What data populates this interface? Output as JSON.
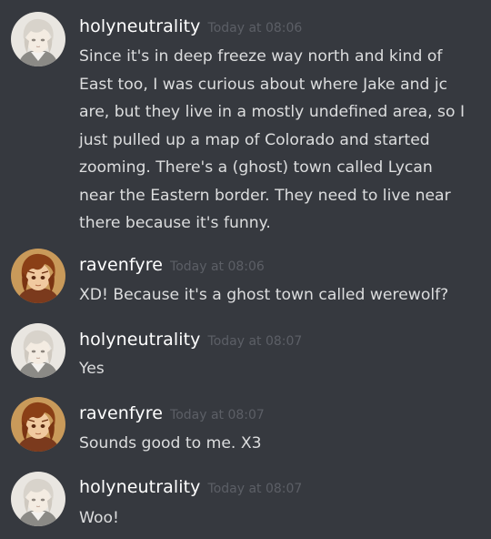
{
  "messages": [
    {
      "username": "holyneutrality",
      "timestamp": "Today at 08:06",
      "avatar": "holyneutrality-avatar",
      "text": "Since it's in deep freeze way north and kind of\nEast too, I was curious about where Jake and jc\nare, but they live in a mostly undefined area, so I\njust pulled up a map of Colorado and started\nzooming. There's a (ghost) town called Lycan\nnear the Eastern border. They need to live near\nthere because it's funny."
    },
    {
      "username": "ravenfyre",
      "timestamp": "Today at 08:06",
      "avatar": "ravenfyre-avatar",
      "text": "XD! Because it's a ghost town called werewolf?"
    },
    {
      "username": "holyneutrality",
      "timestamp": "Today at 08:07",
      "avatar": "holyneutrality-avatar",
      "text": "Yes"
    },
    {
      "username": "ravenfyre",
      "timestamp": "Today at 08:07",
      "avatar": "ravenfyre-avatar",
      "text": "Sounds good to me. X3"
    },
    {
      "username": "holyneutrality",
      "timestamp": "Today at 08:07",
      "avatar": "holyneutrality-avatar",
      "text": "Woo!"
    }
  ],
  "colors": {
    "background": "#36393f",
    "username": "#ffffff",
    "timestamp": "#5c5f66",
    "message_text": "#dcddde"
  }
}
